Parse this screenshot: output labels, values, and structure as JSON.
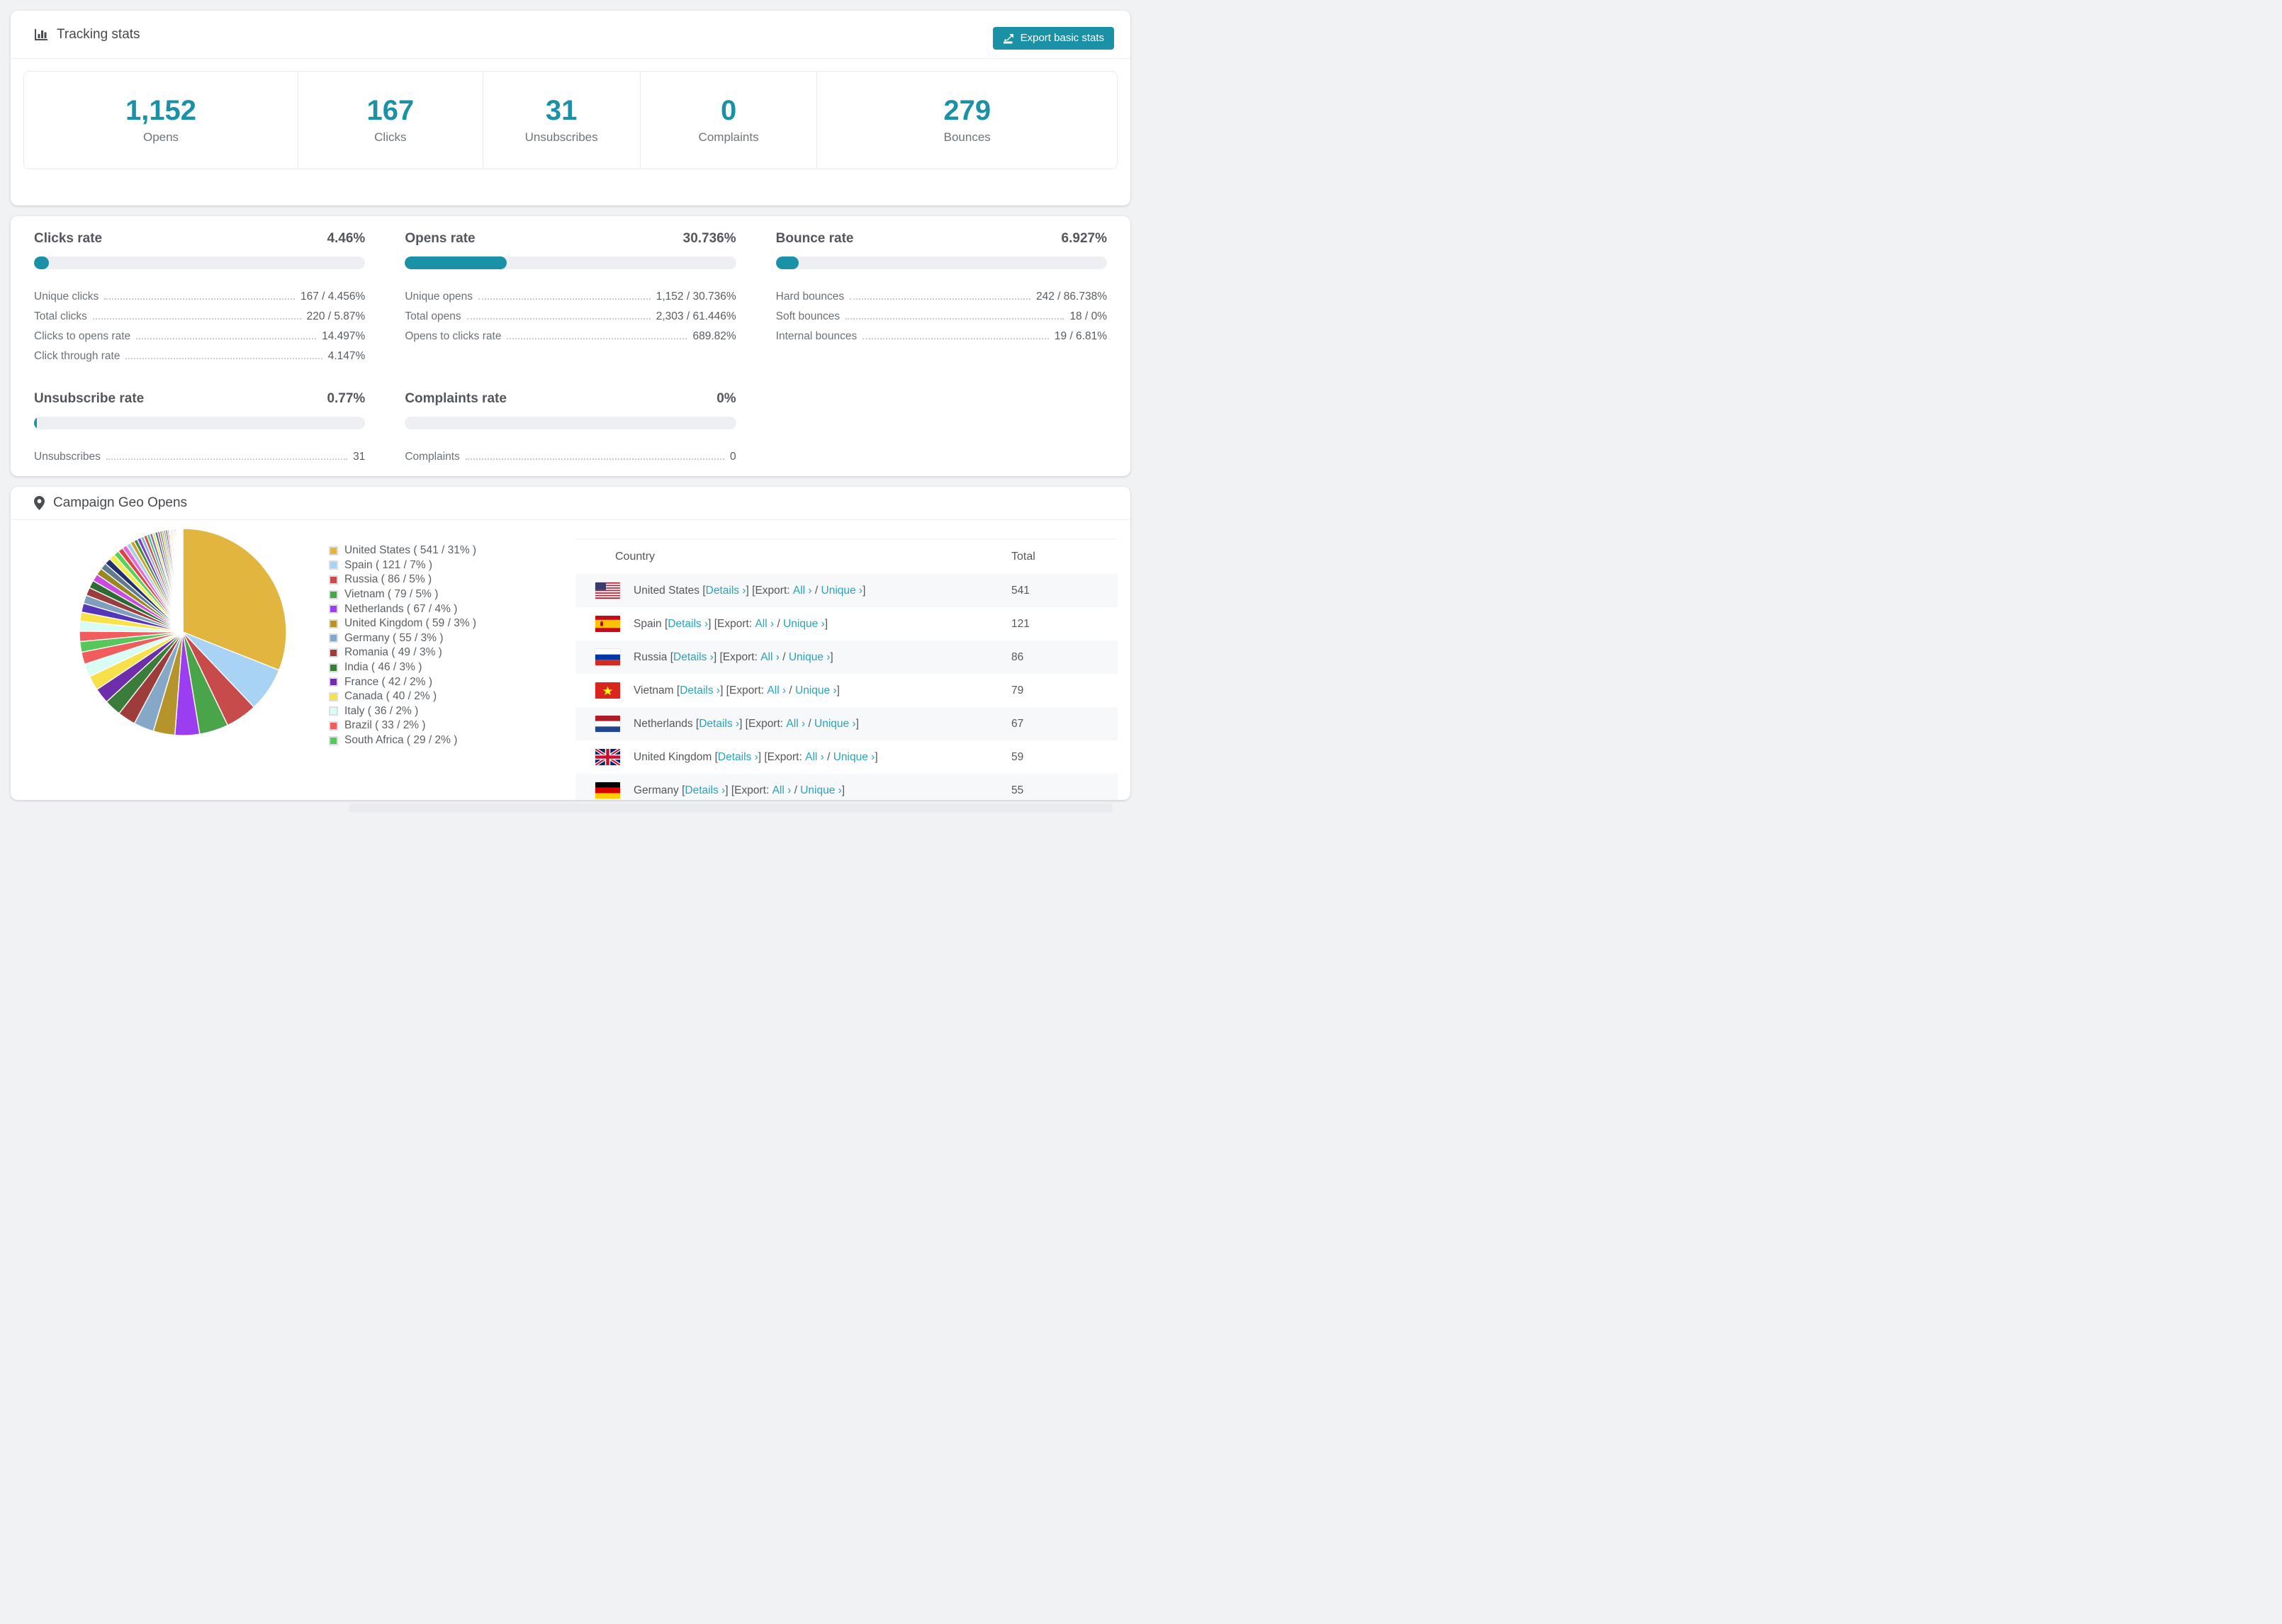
{
  "colors": {
    "accent": "#1b91a8",
    "link": "#28a3b9",
    "bar_track": "#edeff2"
  },
  "tracking": {
    "title": "Tracking stats",
    "export_label": "Export basic stats",
    "stats": [
      {
        "value": "1,152",
        "label": "Opens"
      },
      {
        "value": "167",
        "label": "Clicks"
      },
      {
        "value": "31",
        "label": "Unsubscribes"
      },
      {
        "value": "0",
        "label": "Complaints"
      },
      {
        "value": "279",
        "label": "Bounces"
      }
    ]
  },
  "rates": [
    {
      "title": "Clicks rate",
      "percent": "4.46%",
      "bar_percent": 4.46,
      "rows": [
        {
          "label": "Unique clicks",
          "value": "167 / 4.456%"
        },
        {
          "label": "Total clicks",
          "value": "220 / 5.87%"
        },
        {
          "label": "Clicks to opens rate",
          "value": "14.497%"
        },
        {
          "label": "Click through rate",
          "value": "4.147%"
        }
      ]
    },
    {
      "title": "Opens rate",
      "percent": "30.736%",
      "bar_percent": 30.736,
      "rows": [
        {
          "label": "Unique opens",
          "value": "1,152 / 30.736%"
        },
        {
          "label": "Total opens",
          "value": "2,303 / 61.446%"
        },
        {
          "label": "Opens to clicks rate",
          "value": "689.82%"
        }
      ]
    },
    {
      "title": "Bounce rate",
      "percent": "6.927%",
      "bar_percent": 6.927,
      "rows": [
        {
          "label": "Hard bounces",
          "value": "242 / 86.738%"
        },
        {
          "label": "Soft bounces",
          "value": "18 / 0%"
        },
        {
          "label": "Internal bounces",
          "value": "19 / 6.81%"
        }
      ]
    },
    {
      "title": "Unsubscribe rate",
      "percent": "0.77%",
      "bar_percent": 0.77,
      "rows": [
        {
          "label": "Unsubscribes",
          "value": "31"
        }
      ]
    },
    {
      "title": "Complaints rate",
      "percent": "0%",
      "bar_percent": 0,
      "rows": [
        {
          "label": "Complaints",
          "value": "0"
        }
      ]
    }
  ],
  "geo": {
    "title": "Campaign Geo Opens",
    "links": {
      "details": "Details ›",
      "export": "Export:",
      "all": "All ›",
      "unique": "Unique ›"
    },
    "table": {
      "headers": [
        "Country",
        "Total"
      ],
      "rows": [
        {
          "flag": "us",
          "country": "United States",
          "total": "541"
        },
        {
          "flag": "es",
          "country": "Spain",
          "total": "121"
        },
        {
          "flag": "ru",
          "country": "Russia",
          "total": "86"
        },
        {
          "flag": "vn",
          "country": "Vietnam",
          "total": "79"
        },
        {
          "flag": "nl",
          "country": "Netherlands",
          "total": "67"
        },
        {
          "flag": "gb",
          "country": "United Kingdom",
          "total": "59"
        },
        {
          "flag": "de",
          "country": "Germany",
          "total": "55"
        }
      ]
    }
  },
  "chart_data": {
    "type": "pie",
    "title": "Campaign Geo Opens",
    "legend_position": "right",
    "start_angle": -90,
    "direction": "clockwise",
    "labels": [
      "United States",
      "Spain",
      "Russia",
      "Vietnam",
      "Netherlands",
      "United Kingdom",
      "Germany",
      "Romania",
      "India",
      "France",
      "Canada",
      "Italy",
      "Brazil",
      "South Africa"
    ],
    "values": [
      541,
      121,
      86,
      79,
      67,
      59,
      55,
      49,
      46,
      42,
      40,
      36,
      33,
      29
    ],
    "percents": [
      31,
      7,
      5,
      5,
      4,
      3,
      3,
      3,
      3,
      2,
      2,
      2,
      2,
      2
    ],
    "colors": [
      "#e2b53e",
      "#a9d3f4",
      "#c84b4b",
      "#49a44a",
      "#9b3df0",
      "#b5952b",
      "#85a7c8",
      "#9e3b3b",
      "#3a7d3a",
      "#6e2dab",
      "#f8e04b",
      "#d9fcf5",
      "#f15c5c",
      "#58c75b"
    ],
    "unlabeled_tail_values": [
      28,
      27,
      25,
      24,
      23,
      22,
      21,
      20,
      19,
      18,
      17,
      16,
      15,
      14,
      13,
      12,
      11,
      10,
      10,
      9,
      9,
      8,
      8,
      7,
      7,
      6,
      6,
      5,
      5,
      5,
      4,
      4,
      4,
      3,
      3,
      3,
      3,
      2,
      2,
      2,
      2,
      2,
      1,
      1,
      1,
      1,
      1,
      1,
      1,
      1
    ],
    "tail_palette": [
      "#f15c5c",
      "#d8fbf3",
      "#f7e24a",
      "#5636b8",
      "#7f9dbd",
      "#993d3d",
      "#2e6b34",
      "#cb4ae0",
      "#9a8722",
      "#5f7b8d",
      "#23306e",
      "#f2ee4c",
      "#58d05a",
      "#e04343",
      "#e668d9",
      "#a8cdf0",
      "#c9a227",
      "#3f8f3f",
      "#7d3fc9",
      "#87b5d6",
      "#d94f4f",
      "#4bc47e",
      "#8f6db8",
      "#e8e34e",
      "#356e99",
      "#b84a8f",
      "#6ba84a",
      "#d98e3a",
      "#4aa3b8",
      "#9c3a5e"
    ]
  }
}
